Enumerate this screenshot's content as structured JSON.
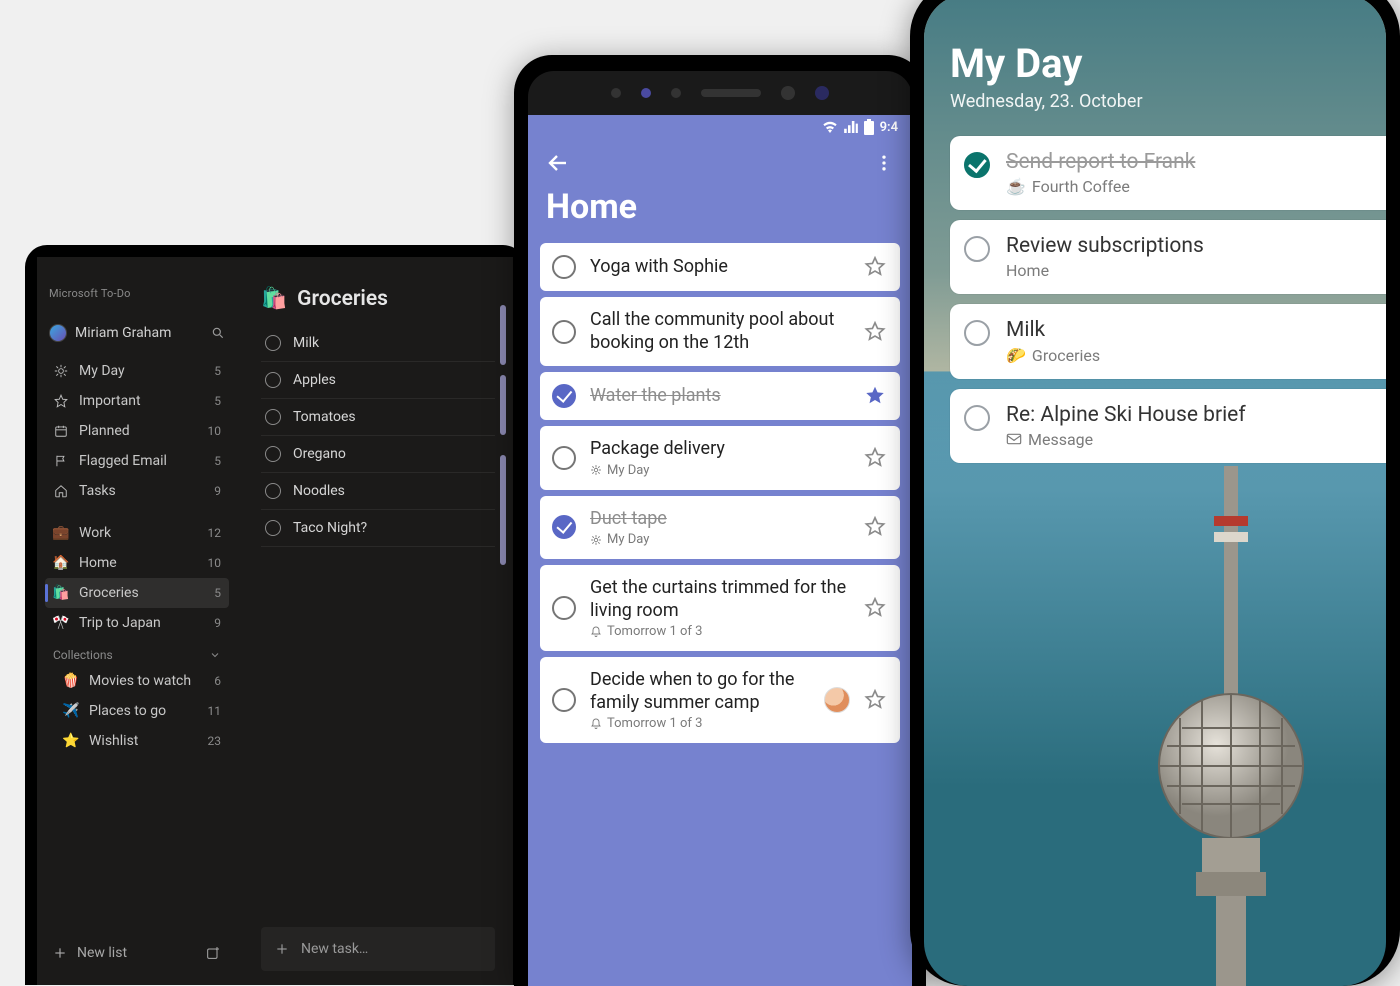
{
  "colors": {
    "android_accent": "#7682cf",
    "android_primary": "#5967c5",
    "ios_accent": "#0b746c"
  },
  "tablet": {
    "app_name": "Microsoft To-Do",
    "user_name": "Miriam Graham",
    "sidebar": {
      "smart": [
        {
          "icon": "sun",
          "label": "My Day",
          "count": "5"
        },
        {
          "icon": "star",
          "label": "Important",
          "count": "5"
        },
        {
          "icon": "cal",
          "label": "Planned",
          "count": "10"
        },
        {
          "icon": "flag",
          "label": "Flagged Email",
          "count": "5"
        },
        {
          "icon": "home",
          "label": "Tasks",
          "count": "9"
        }
      ],
      "lists": [
        {
          "emoji": "💼",
          "label": "Work",
          "count": "12"
        },
        {
          "emoji": "🏠",
          "label": "Home",
          "count": "10"
        },
        {
          "emoji": "🛍️",
          "label": "Groceries",
          "count": "5",
          "active": true
        },
        {
          "emoji": "🎌",
          "label": "Trip to Japan",
          "count": "9"
        }
      ],
      "collections_label": "Collections",
      "collections": [
        {
          "emoji": "🍿",
          "label": "Movies to watch",
          "count": "6"
        },
        {
          "emoji": "✈️",
          "label": "Places to go",
          "count": "11"
        },
        {
          "emoji": "⭐",
          "label": "Wishlist",
          "count": "23"
        }
      ],
      "new_list_label": "New list"
    },
    "main": {
      "list_emoji": "🛍️",
      "list_title": "Groceries",
      "tasks": [
        {
          "title": "Milk"
        },
        {
          "title": "Apples"
        },
        {
          "title": "Tomatoes"
        },
        {
          "title": "Oregano"
        },
        {
          "title": "Noodles"
        },
        {
          "title": "Taco Night?"
        }
      ],
      "new_task_placeholder": "New task…"
    }
  },
  "android": {
    "status_time": "9:4",
    "list_title": "Home",
    "tasks": [
      {
        "title": "Yoga with Sophie",
        "done": false,
        "starred": false
      },
      {
        "title": "Call the community pool about booking on the 12th",
        "done": false,
        "starred": false
      },
      {
        "title": "Water the plants",
        "done": true,
        "starred": true
      },
      {
        "title": "Package delivery",
        "sub_icon": "sun",
        "sub": "My Day",
        "done": false,
        "starred": false
      },
      {
        "title": "Duct tape",
        "sub_icon": "sun",
        "sub": "My Day",
        "done": true,
        "starred": false
      },
      {
        "title": "Get the curtains trimmed for the living room",
        "sub_icon": "bell",
        "sub": "Tomorrow  1 of 3",
        "done": false,
        "starred": false
      },
      {
        "title": "Decide when to go for the family summer camp",
        "sub_icon": "bell",
        "sub": "Tomorrow  1 of 3",
        "done": false,
        "starred": false,
        "assignee": true
      }
    ]
  },
  "iphone": {
    "title": "My Day",
    "date": "Wednesday, 23. October",
    "tasks": [
      {
        "title": "Send report to Frank",
        "sub_emoji": "☕",
        "sub": "Fourth Coffee",
        "done": true
      },
      {
        "title": "Review subscriptions",
        "sub": "Home",
        "done": false
      },
      {
        "title": "Milk",
        "sub_emoji": "🌮",
        "sub": "Groceries",
        "done": false
      },
      {
        "title": "Re: Alpine Ski House brief",
        "sub_icon": "mail",
        "sub": "Message",
        "done": false
      }
    ]
  }
}
